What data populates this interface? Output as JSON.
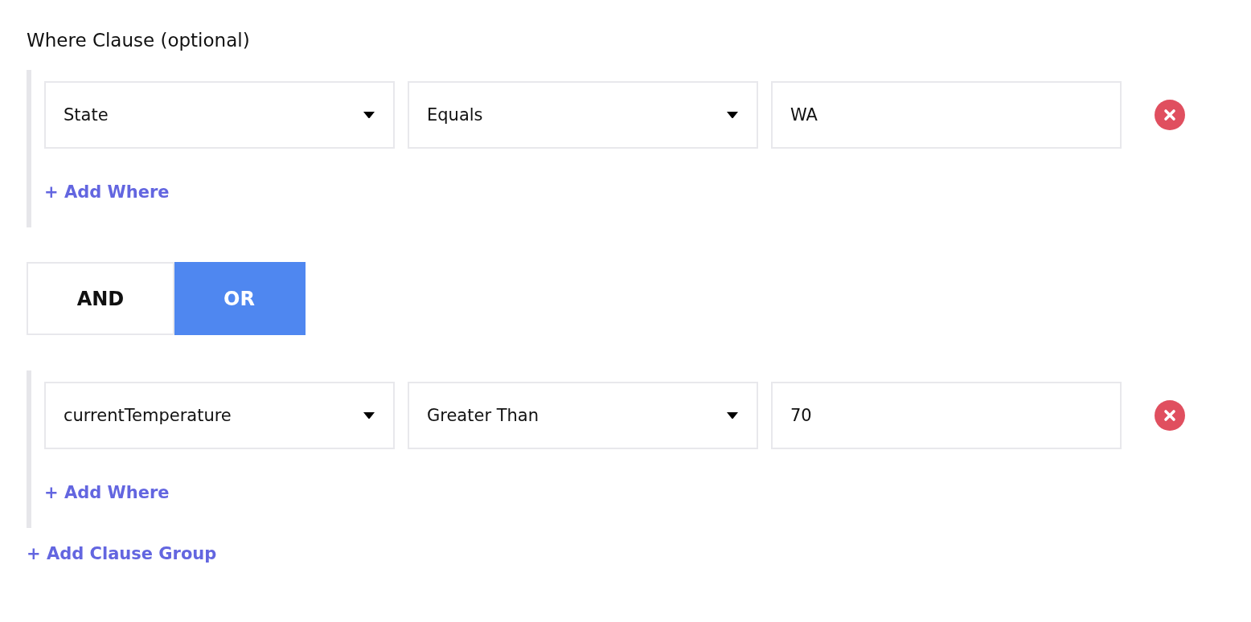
{
  "title": "Where Clause (optional)",
  "groups": [
    {
      "conditions": [
        {
          "field": "State",
          "operator": "Equals",
          "value": "WA"
        }
      ],
      "add_where": "+ Add Where"
    },
    {
      "conditions": [
        {
          "field": "currentTemperature",
          "operator": "Greater Than",
          "value": "70"
        }
      ],
      "add_where": "+ Add Where"
    }
  ],
  "combinator": [
    {
      "label": "AND",
      "selected": false
    },
    {
      "label": "OR",
      "selected": true
    }
  ],
  "add_clause_group": "+ Add Clause Group"
}
